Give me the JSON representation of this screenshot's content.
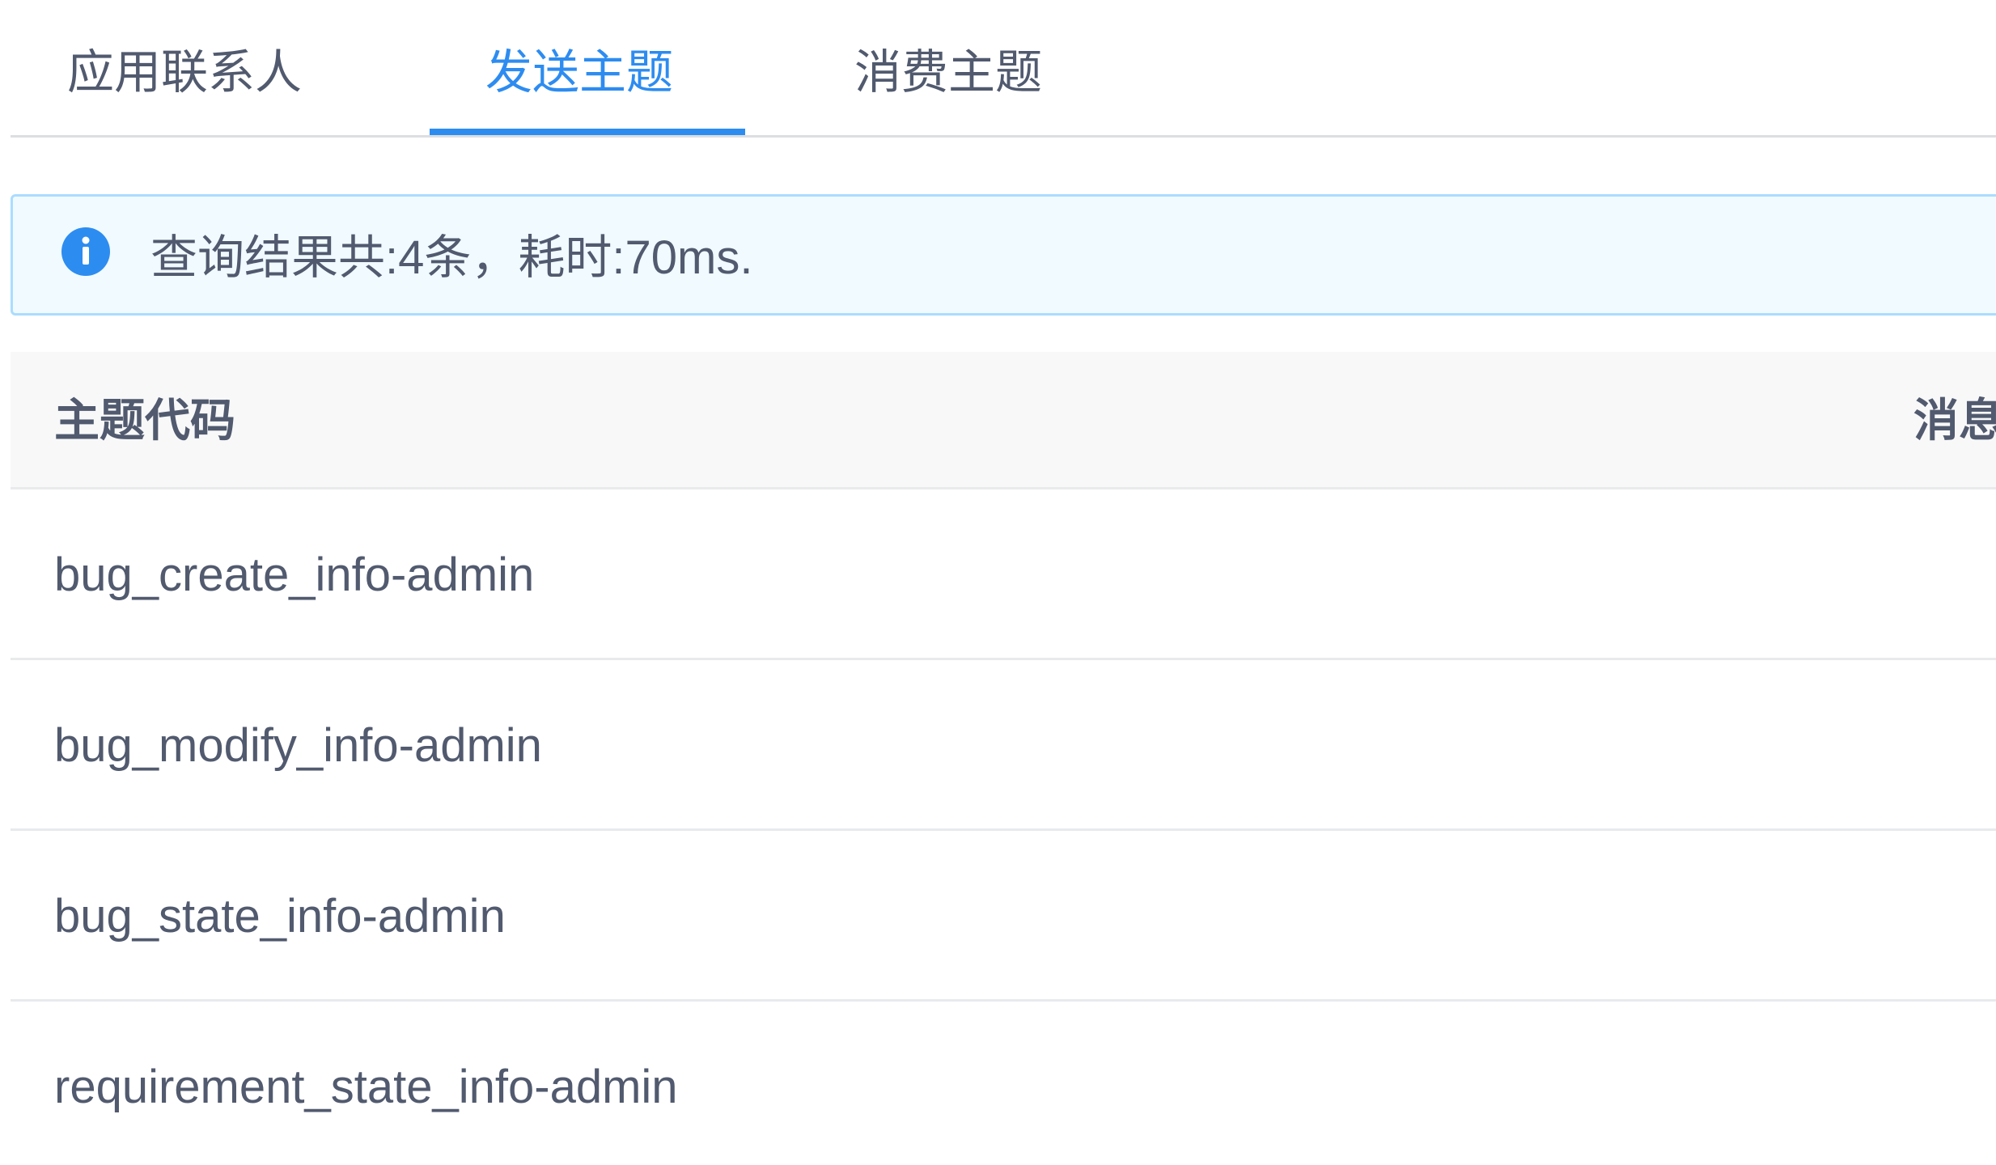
{
  "tabs": [
    {
      "label": "应用联系人",
      "active": false
    },
    {
      "label": "发送主题",
      "active": true
    },
    {
      "label": "消费主题",
      "active": false
    }
  ],
  "alert": {
    "icon": "info-circle-icon",
    "text": "查询结果共:4条，耗时:70ms."
  },
  "table": {
    "columns": [
      "主题代码",
      "消息"
    ],
    "rows": [
      {
        "topic_code": "bug_create_info-admin"
      },
      {
        "topic_code": "bug_modify_info-admin"
      },
      {
        "topic_code": "bug_state_info-admin"
      },
      {
        "topic_code": "requirement_state_info-admin"
      }
    ]
  },
  "colors": {
    "accent": "#2d8cf0",
    "text": "#515a6e",
    "alert_bg": "#f0faff",
    "alert_border": "#abdcff",
    "table_header_bg": "#f8f8f9"
  }
}
